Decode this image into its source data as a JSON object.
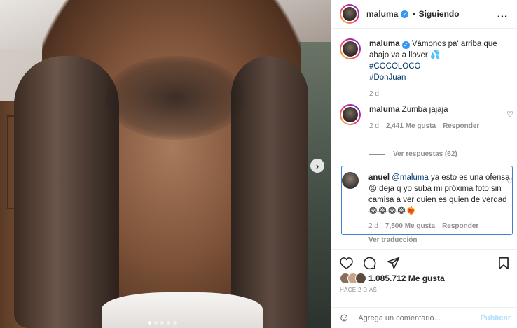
{
  "header": {
    "username": "maluma",
    "separator": "•",
    "follow_label": "Siguiendo",
    "more_icon": "…"
  },
  "caption": {
    "username": "maluma",
    "text": "Vámonos pa' arriba que abajo va a llover 💦",
    "hashtags": [
      "#COCOLOCO",
      "#DonJuan"
    ],
    "time": "2 d"
  },
  "comments": [
    {
      "username": "maluma",
      "text": "Zumba jajaja",
      "time": "2 d",
      "likes": "2,441 Me gusta",
      "reply_label": "Responder"
    }
  ],
  "view_replies": "Ver respuestas (62)",
  "reply": {
    "username": "anuel",
    "mention": "@maluma",
    "text": "ya esto es una ofensa 😡 deja q yo suba mi próxima foto sin camisa a ver quien es quien de verdad 😂😂😂😂❤️‍🔥",
    "time": "2 d",
    "likes": "7,500 Me gusta",
    "reply_label": "Responder",
    "translate": "Ver traducción"
  },
  "likes_count": "1.085.712 Me gusta",
  "timestamp": "HACE 2 DÍAS",
  "add_comment": {
    "placeholder": "Agrega un comentario...",
    "publish_label": "Publicar"
  },
  "colors": {
    "link": "#00376b",
    "verified": "#3897f0",
    "highlight_border": "#3f7fd9",
    "publish_disabled": "#b2dffc"
  }
}
